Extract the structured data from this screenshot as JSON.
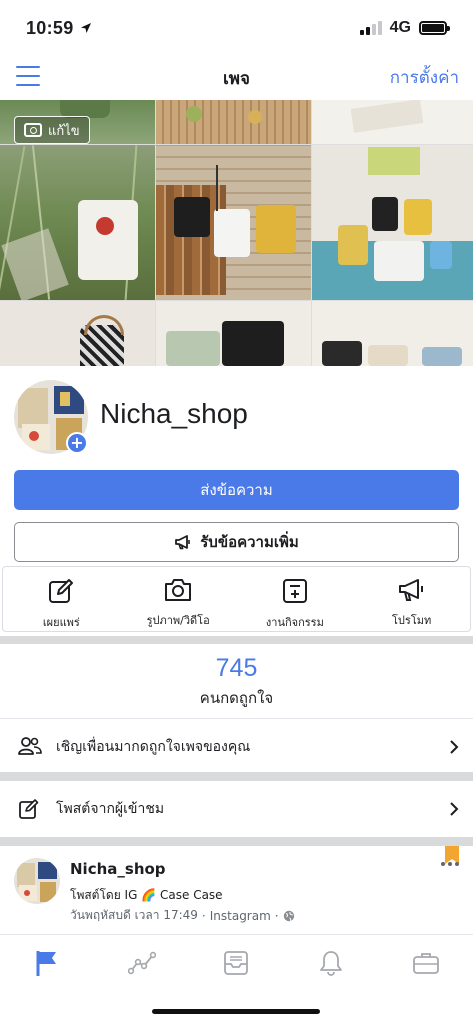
{
  "status": {
    "time": "10:59",
    "network": "4G"
  },
  "nav": {
    "title": "เพจ",
    "settings": "การตั้งค่า"
  },
  "cover": {
    "edit_label": "แก้ไข"
  },
  "profile": {
    "name": "Nicha_shop"
  },
  "buttons": {
    "message": "ส่งข้อความ",
    "get_more_messages": "รับข้อความเพิ่ม"
  },
  "actions": [
    {
      "label": "เผยแพร่",
      "icon": "edit-icon"
    },
    {
      "label": "รูปภาพ/วิดีโอ",
      "icon": "camera-icon"
    },
    {
      "label": "งานกิจกรรม",
      "icon": "event-icon"
    },
    {
      "label": "โปรโมท",
      "icon": "megaphone-icon"
    }
  ],
  "likes": {
    "count": "745",
    "label": "คนกดถูกใจ"
  },
  "invite": {
    "label": "เชิญเพื่อนมากดถูกใจเพจของคุณ"
  },
  "visitor_posts": {
    "label": "โพสต์จากผู้เข้าชม"
  },
  "post": {
    "author": "Nicha_shop",
    "by_prefix": "โพสต์โดย IG",
    "by_emoji": "🌈",
    "by_name": "Case Case",
    "time": "วันพฤหัสบดี เวลา 17:49",
    "source": "Instagram",
    "separator": "·"
  },
  "tabs": [
    "flag-icon",
    "insights-icon",
    "inbox-icon",
    "bell-icon",
    "briefcase-icon"
  ],
  "colors": {
    "accent": "#4a7ae8",
    "bookmark": "#f2a530",
    "divider": "#d9dadc"
  }
}
